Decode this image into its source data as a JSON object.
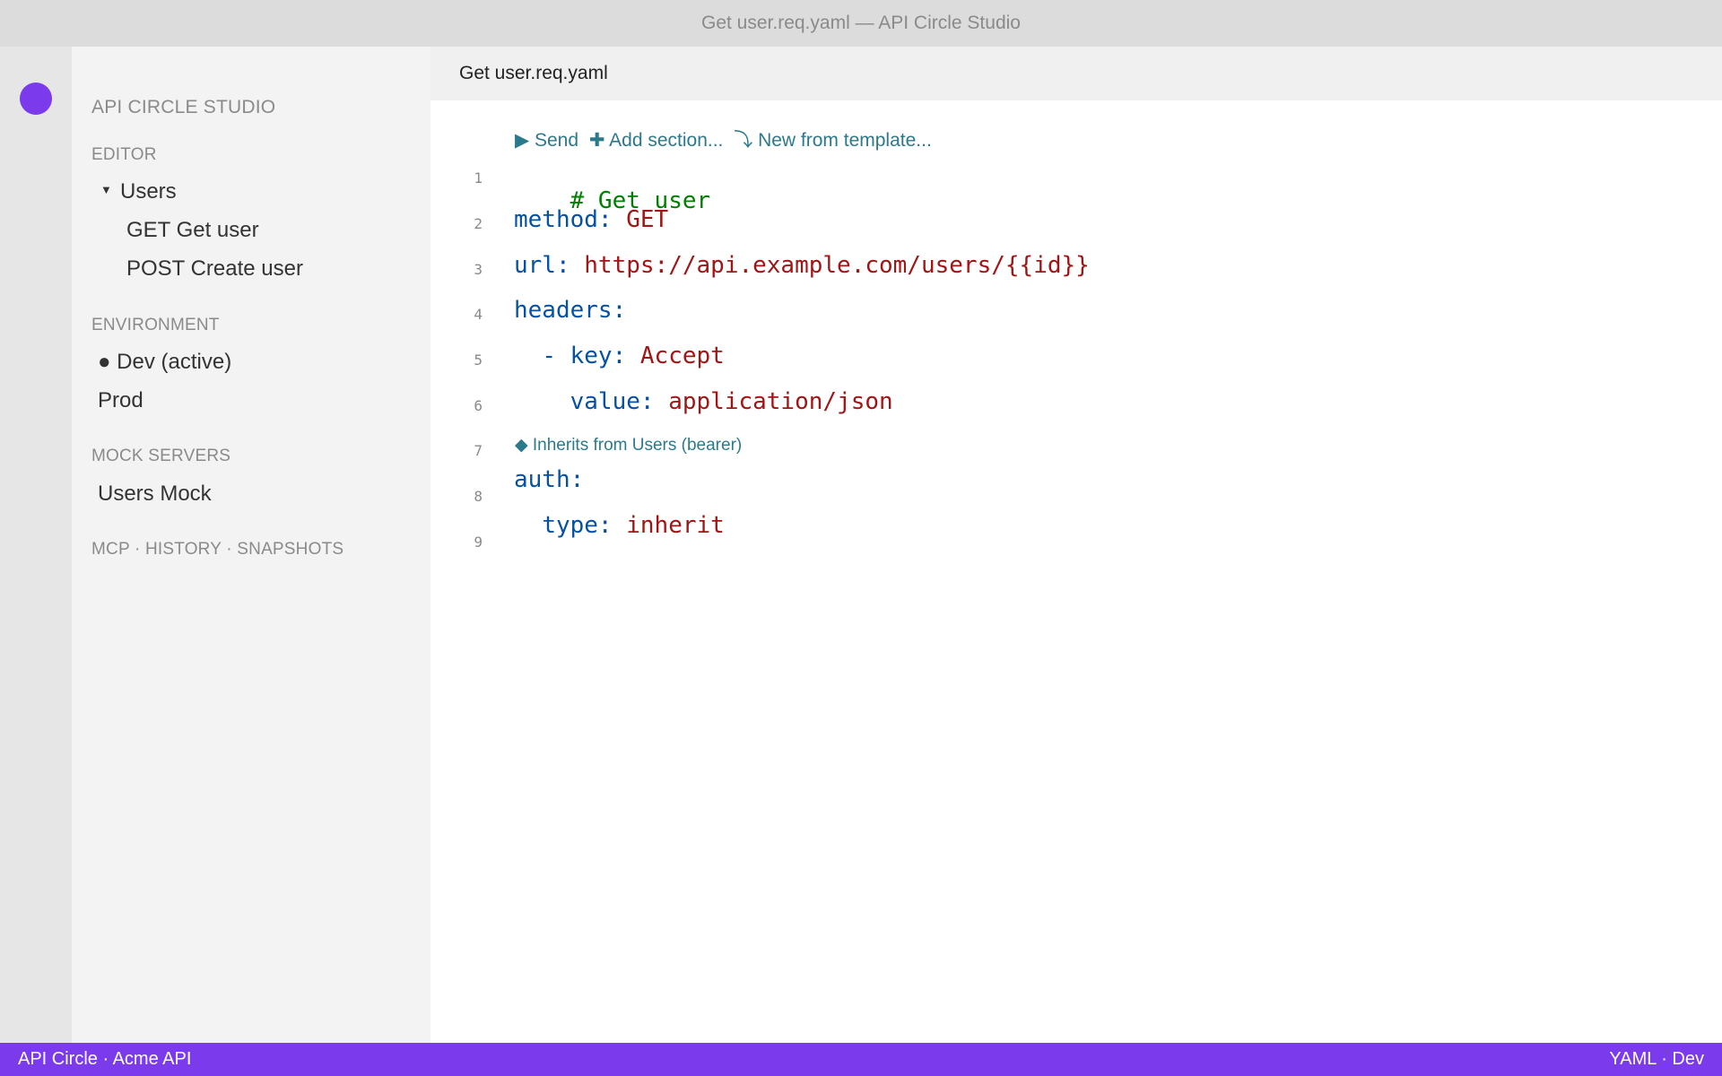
{
  "window": {
    "title": "Get user.req.yaml — API Circle Studio"
  },
  "sidebar": {
    "app_name": "API CIRCLE STUDIO",
    "editor_header": "EDITOR",
    "collection": {
      "name": "Users",
      "requests": [
        {
          "label": "GET Get user"
        },
        {
          "label": "POST Create user"
        }
      ]
    },
    "environment_header": "ENVIRONMENT",
    "environments": [
      {
        "label": "● Dev (active)"
      },
      {
        "label": "Prod"
      }
    ],
    "mock_header": "MOCK SERVERS",
    "mocks": [
      {
        "label": "Users Mock"
      }
    ],
    "footer_links": "MCP · HISTORY · SNAPSHOTS"
  },
  "tab": {
    "label": "Get user.req.yaml"
  },
  "codelens": {
    "send": "▶ Send",
    "add_section": "✚ Add section...",
    "new_from_template": "⤵ New from template..."
  },
  "inherit_lens": "◆ Inherits from Users (bearer)",
  "code": {
    "line_numbers": [
      "1",
      "2",
      "3",
      "4",
      "5",
      "6",
      "7",
      "8",
      "9"
    ],
    "l1_comment": "# Get user",
    "l2_key": "method:",
    "l2_val": "GET",
    "l3_key": "url:",
    "l3_val": "https://api.example.com/users/{{id}}",
    "l4_key": "headers:",
    "l5_key": "- key:",
    "l5_val": "Accept",
    "l6_key": "value:",
    "l6_val": "application/json",
    "l8_key": "auth:",
    "l9_key": "type:",
    "l9_val": "inherit"
  },
  "statusbar": {
    "left": "API Circle · Acme API",
    "right": "YAML · Dev"
  },
  "colors": {
    "accent": "#7c3aed",
    "comment": "#008000",
    "key": "#0451a5",
    "value": "#a31515",
    "codelens": "#2b7a8c"
  }
}
